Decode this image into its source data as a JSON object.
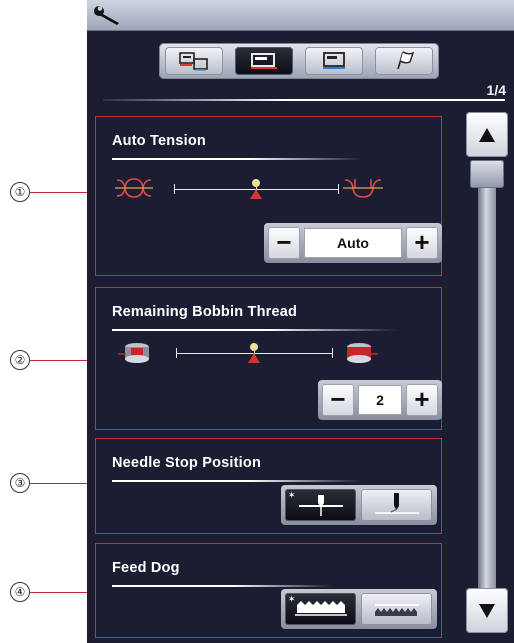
{
  "callouts": [
    "①",
    "②",
    "③",
    "④"
  ],
  "toolbar": {
    "wrench_icon": "wrench-icon"
  },
  "mode_tabs": [
    {
      "icon": "machine-embroidery-pair-icon",
      "active": false
    },
    {
      "icon": "sewing-machine-icon",
      "active": true
    },
    {
      "icon": "embroidery-machine-icon",
      "active": false
    },
    {
      "icon": "flag-icon",
      "active": false
    }
  ],
  "page_indicator": "1/4",
  "settings": {
    "auto_tension": {
      "title": "Auto Tension",
      "left_icon": "loose-tension-icon",
      "right_icon": "tight-tension-icon",
      "slider_position": 0.5,
      "value": "Auto",
      "minus": "−",
      "plus": "+"
    },
    "bobbin_thread": {
      "title": "Remaining Bobbin Thread",
      "left_icon": "empty-bobbin-icon",
      "right_icon": "full-bobbin-icon",
      "slider_position": 0.5,
      "value": "2",
      "minus": "−",
      "plus": "+"
    },
    "needle_stop": {
      "title": "Needle Stop Position",
      "options": [
        "needle-down-icon",
        "needle-up-icon"
      ],
      "selected": 0
    },
    "feed_dog": {
      "title": "Feed Dog",
      "options": [
        "feed-dog-up-icon",
        "feed-dog-down-icon"
      ],
      "selected": 0
    }
  },
  "scroll": {
    "up_icon": "scroll-up-icon",
    "down_icon": "scroll-down-icon"
  },
  "colors": {
    "accent": "#c8303a",
    "screen_bg": "#1b1d33",
    "marker": "#d3342f"
  }
}
